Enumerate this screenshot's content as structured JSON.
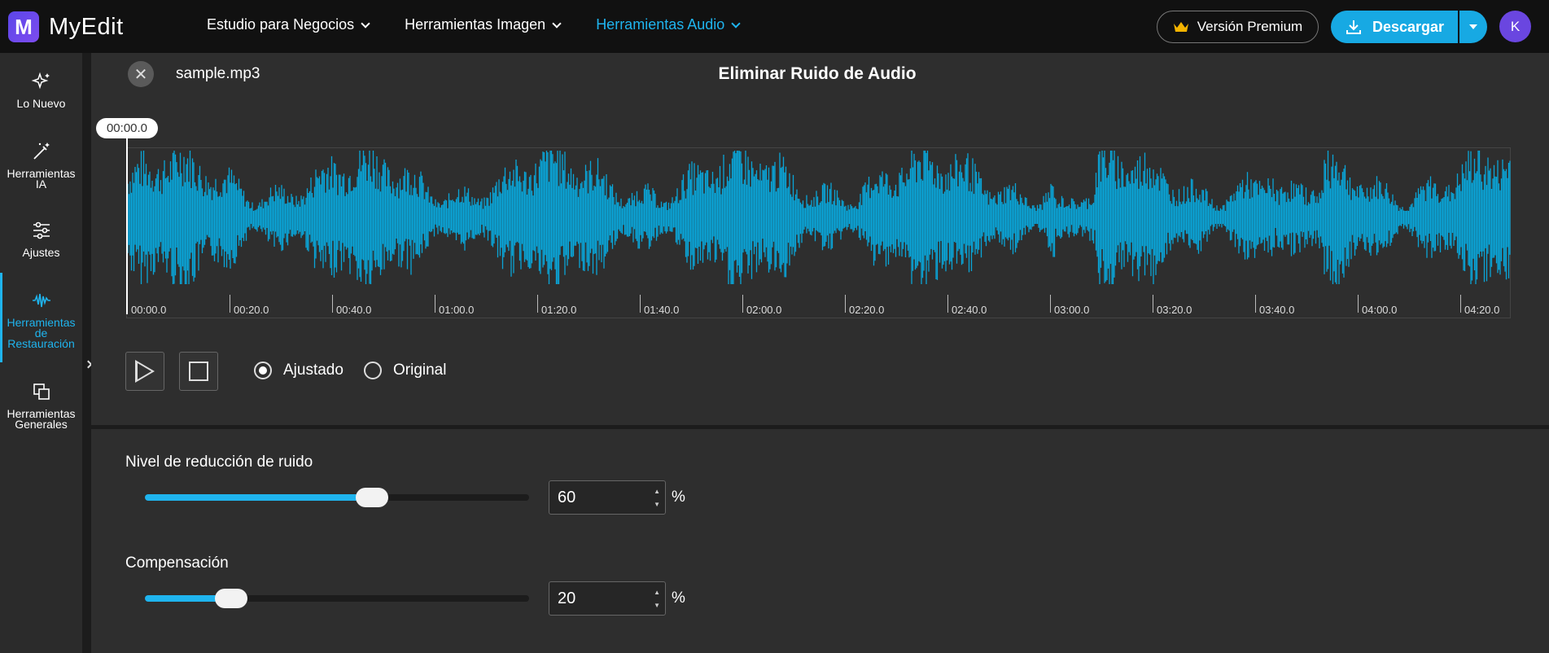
{
  "brand": {
    "name": "MyEdit",
    "logo_letter": "M",
    "accent": "#1fb4ee"
  },
  "nav": [
    {
      "label": "Estudio para Negocios",
      "active": false
    },
    {
      "label": "Herramientas Imagen",
      "active": false
    },
    {
      "label": "Herramientas Audio",
      "active": true
    }
  ],
  "header": {
    "premium_label": "Versión Premium",
    "download_label": "Descargar",
    "avatar_initial": "K"
  },
  "sidebar": {
    "items": [
      {
        "label": "Lo Nuevo",
        "icon": "sparkles-icon"
      },
      {
        "label": "Herramientas IA",
        "icon": "magic-wand-icon"
      },
      {
        "label": "Ajustes",
        "icon": "sliders-icon"
      },
      {
        "label": "Herramientas de Restauración",
        "icon": "waveform-icon",
        "active": true
      },
      {
        "label": "Herramientas Generales",
        "icon": "layers-icon"
      }
    ]
  },
  "editor": {
    "filename": "sample.mp3",
    "title": "Eliminar Ruido de Audio",
    "current_time": "00:00.0",
    "ticks": [
      "00:00.0",
      "00:20.0",
      "00:40.0",
      "01:00.0",
      "01:20.0",
      "01:40.0",
      "02:00.0",
      "02:20.0",
      "02:40.0",
      "03:00.0",
      "03:20.0",
      "03:40.0",
      "04:00.0",
      "04:20.0"
    ],
    "wave_color": "#0aa5d8"
  },
  "playback": {
    "modes": [
      {
        "label": "Ajustado",
        "selected": true
      },
      {
        "label": "Original",
        "selected": false
      }
    ]
  },
  "settings": {
    "noise": {
      "label": "Nivel de reducción de ruido",
      "value": "60",
      "unit": "%",
      "level": 0.6
    },
    "compensation": {
      "label": "Compensación",
      "value": "20",
      "unit": "%",
      "level": 0.2
    }
  }
}
